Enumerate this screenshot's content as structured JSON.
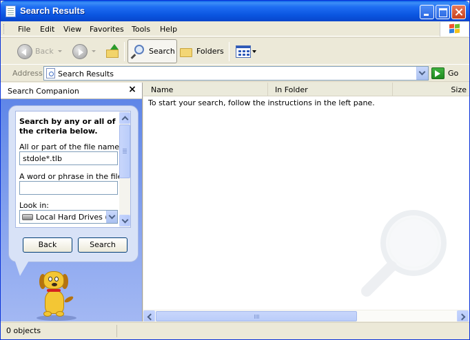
{
  "window": {
    "title": "Search Results"
  },
  "menu": [
    "File",
    "Edit",
    "View",
    "Favorites",
    "Tools",
    "Help"
  ],
  "toolbar": {
    "back_label": "Back",
    "search_label": "Search",
    "folders_label": "Folders"
  },
  "address": {
    "label": "Address",
    "value": "Search Results",
    "go_label": "Go"
  },
  "companion": {
    "title": "Search Companion",
    "close_glyph": "×",
    "criteria_heading": "Search by any or all of the criteria below.",
    "filename_label": "All or part of the file name:",
    "filename_value": "stdole*.tlb",
    "phrase_label": "A word or phrase in the file:",
    "phrase_value": "",
    "lookin_label": "Look in:",
    "lookin_value": "Local Hard Drives (C:",
    "back_button": "Back",
    "search_button": "Search"
  },
  "results": {
    "columns": [
      "Name",
      "In Folder",
      "Size"
    ],
    "instructions": "To start your search, follow the instructions in the left pane."
  },
  "status": {
    "text": "0 objects"
  },
  "colors": {
    "titlebar": "#0a55e0",
    "pane_blue": "#7a95e6",
    "chrome": "#ece9d8"
  }
}
